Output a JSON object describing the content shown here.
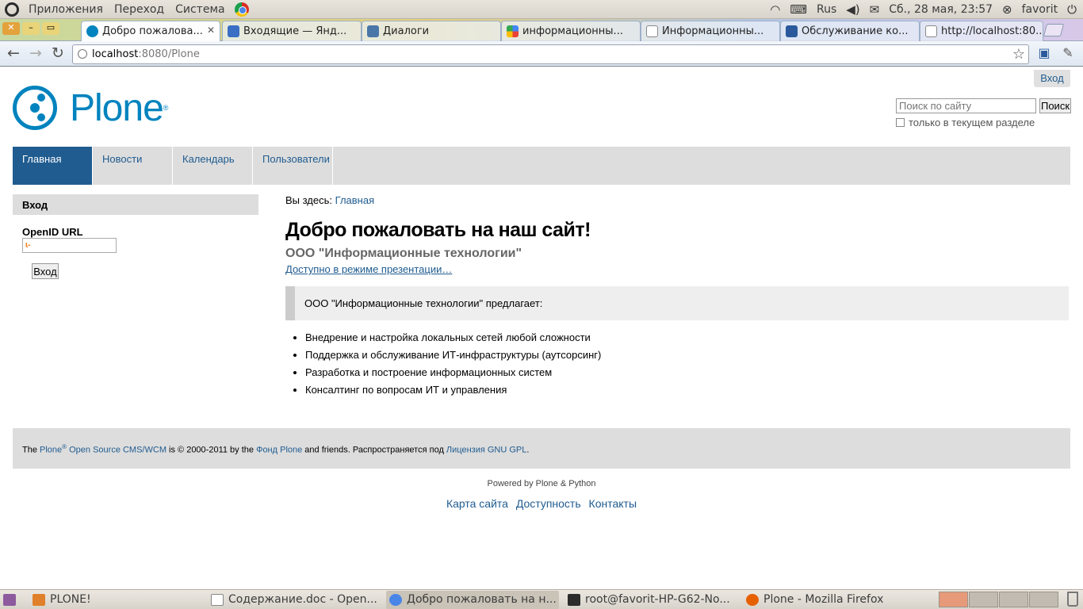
{
  "top_panel": {
    "menu": [
      "Приложения",
      "Переход",
      "Система"
    ],
    "keyboard_layout": "Rus",
    "datetime": "Сб., 28 мая, 23:57",
    "user": "favorit"
  },
  "browser": {
    "tabs": [
      {
        "title": "Добро пожалова...",
        "active": true,
        "favicon": "plone-icon"
      },
      {
        "title": "Входящие — Янд...",
        "active": false,
        "favicon": "mail-icon"
      },
      {
        "title": "Диалоги",
        "active": false,
        "favicon": "chat-icon"
      },
      {
        "title": "информационны...",
        "active": false,
        "favicon": "google-icon"
      },
      {
        "title": "Информационны...",
        "active": false,
        "favicon": "document-icon"
      },
      {
        "title": "Обслуживание ко...",
        "active": false,
        "favicon": "zoho-icon"
      },
      {
        "title": "http://localhost:80...",
        "active": false,
        "favicon": "document-icon"
      }
    ],
    "url_host": "localhost",
    "url_rest": ":8080/Plone"
  },
  "site": {
    "personal_login": "Вход",
    "logo_text": "Plone",
    "search": {
      "placeholder": "Поиск по сайту",
      "button": "Поиск",
      "scope_label": "только в текущем разделе"
    },
    "nav_tabs": [
      "Главная",
      "Новости",
      "Календарь",
      "Пользователи"
    ],
    "login_portlet": {
      "header": "Вход",
      "openid_label": "OpenID URL",
      "button": "Вход"
    },
    "breadcrumb": {
      "prefix": "Вы здесь:",
      "link": "Главная"
    },
    "title": "Добро пожаловать на наш сайт!",
    "description": "ООО \"Информационные технологии\"",
    "presentation_link": "Доступно в режиме презентации…",
    "callout": "ООО \"Информационные технологии\" предлагает:",
    "services": [
      "Внедрение и настройка локальных сетей любой сложности",
      "Поддержка и обслуживание ИТ-инфраструктуры (аутсорсинг)",
      "Разработка и построение информационных систем",
      "Консалтинг по вопросам ИТ и управления"
    ],
    "footer": {
      "t1": "The ",
      "plone_link": "Plone",
      "reg": "®",
      "cms_link": " Open Source CMS/WCM",
      "t2": " is © 2000-2011 by the ",
      "foundation_link": "Фонд Plone",
      "t3": " and friends. Распространяется под ",
      "license_link": "Лицензия GNU GPL",
      "t4": "."
    },
    "colophon": "Powered by Plone & Python",
    "site_actions": [
      "Карта сайта",
      "Доступность",
      "Контакты"
    ]
  },
  "taskbar": [
    {
      "title": "PLONE!",
      "active": false
    },
    {
      "title": "Содержание.doc - Open...",
      "active": false
    },
    {
      "title": "Добро пожаловать на н...",
      "active": true
    },
    {
      "title": "root@favorit-HP-G62-No...",
      "active": false
    },
    {
      "title": "Plone - Mozilla Firefox",
      "active": false
    }
  ]
}
